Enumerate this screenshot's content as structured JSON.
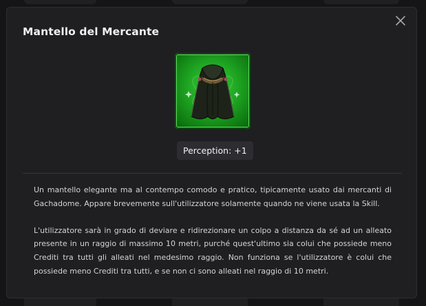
{
  "modal": {
    "title": "Mantello del Mercante",
    "close_icon": "close-icon",
    "item_icon": "cloak-icon",
    "stat": "Perception: +1",
    "description": [
      "Un mantello elegante ma al contempo comodo e pratico, tipicamente usato dai mercanti di Gachadome. Appare brevemente sull'utilizzatore solamente quando ne viene usata la Skill.",
      "L'utilizzatore sarà in grado di deviare e ridirezionare un colpo a distanza da sé ad un alleato presente in un raggio di massimo 10 metri, purché quest'ultimo sia colui che possiede meno Crediti tra tutti gli alleati nel medesimo raggio. Non funziona se l'utilizzatore è colui che possiede meno Crediti tra tutti, e se non ci sono alleati nel raggio di 10 metri."
    ]
  },
  "colors": {
    "modal_bg": "#1f1f22",
    "rarity_green": "#1fa522",
    "text": "#d4d4d8"
  }
}
